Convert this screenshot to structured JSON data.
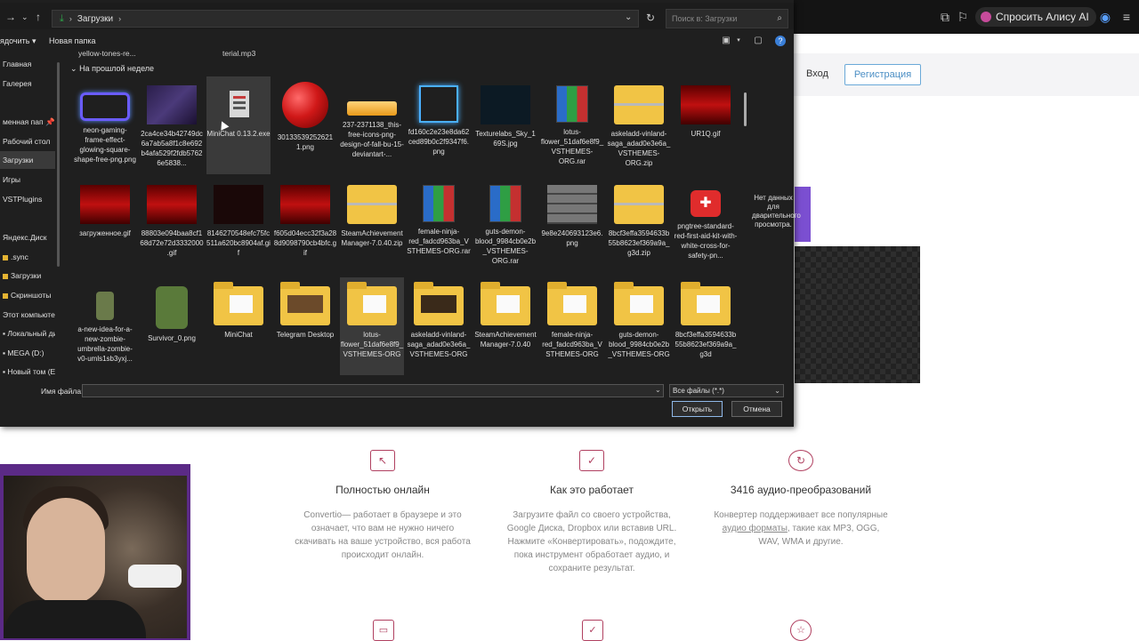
{
  "browser": {
    "alice_label": "Спросить Алису AI"
  },
  "website": {
    "login_label": "Вход",
    "register_label": "Регистрация",
    "features": [
      {
        "title": "Полностью онлайн",
        "text": "Convertio— работает в браузере и это означает, что вам не нужно ничего скачивать на ваше устройство, вся работа происходит онлайн."
      },
      {
        "title": "Как это работает",
        "text": "Загрузите файл со своего устройства, Google Диска, Dropbox или вставив URL. Нажмите «Конвертировать», подождите, пока инструмент обработает аудио, и сохраните результат."
      },
      {
        "title": "3416 аудио-преобразований",
        "text_before": "Конвертер поддерживает все популярные ",
        "text_link": "аудио форматы",
        "text_after": ", такие как MP3, OGG, WAV, WMA и другие."
      }
    ]
  },
  "dialog": {
    "address_path": "Загрузки",
    "search_placeholder": "Поиск в: Загрузки",
    "organize_label": "ядочить ▾",
    "new_folder_label": "Новая папка",
    "sidebar": [
      "Главная",
      "Галерея",
      "менная пап",
      "Рабочий стол",
      "Загрузки",
      "Игры",
      "VSTPlugins",
      "Яндекс.Диск",
      ".sync",
      "Загрузки",
      "Скриншоты",
      "Этот компьюте",
      "Локальный ди",
      "MEGA (D:)",
      "Новый том (E"
    ],
    "top_partial_labels": [
      "yellow-tones-re...",
      "terial.mp3"
    ],
    "group_header": "На прошлой неделе",
    "files": [
      {
        "name": "neon-gaming-frame-effect-glowing-square-shape-free-png.png",
        "thumb": "neon"
      },
      {
        "name": "2ca4ce34b42749dc6a7ab5a8f1c8e692b4afa529f2fdb57626e5838...",
        "thumb": "galaxy"
      },
      {
        "name": "MiniChat 0.13.2.exe",
        "thumb": "exe"
      },
      {
        "name": "30133539252621 1.png",
        "thumb": "ball"
      },
      {
        "name": "237-2371138_this-free-icons-png-design-of-fall-bu-15-deviantart-...",
        "thumb": "bar"
      },
      {
        "name": "fd160c2e23e8da62ced89b0c2f9347f6.png",
        "thumb": "sq"
      },
      {
        "name": "Texturelabs_Sky_169S.jpg",
        "thumb": "space"
      },
      {
        "name": "lotus-flower_51daf6e8f9_VSTHEMES-ORG.rar",
        "thumb": "rar"
      },
      {
        "name": "askeladd-vinland-saga_adad0e3e6a_VSTHEMES-ORG.zip",
        "thumb": "zip"
      },
      {
        "name": "UR1Q.gif",
        "thumb": "red"
      },
      {
        "name": "загруженное.gif",
        "thumb": "red"
      },
      {
        "name": "88803e094baa8cf168d72e72d3332000.gif",
        "thumb": "red"
      },
      {
        "name": "8146270548efc75fc511a620bc8904af.gif",
        "thumb": "dark"
      },
      {
        "name": "f605d04ecc32f3a288d9098790cb4bfc.gif",
        "thumb": "red"
      },
      {
        "name": "SteamAchievementManager-7.0.40.zip",
        "thumb": "zip"
      },
      {
        "name": "female-ninja-red_fadcd963ba_VSTHEMES-ORG.rar",
        "thumb": "rar"
      },
      {
        "name": "guts-demon-blood_9984cb0e2b_VSTHEMES-ORG.rar",
        "thumb": "rar"
      },
      {
        "name": "9e8e240693123e6.png",
        "thumb": "brick"
      },
      {
        "name": "8bcf3effa3594633b55b8623ef369a9a_g3d.zip",
        "thumb": "zip"
      },
      {
        "name": "pngtree-standard-red-first-aid-kit-with-white-cross-for-safety-pn...",
        "thumb": "aid"
      },
      {
        "name": "a-new-idea-for-a-new-zombie-umbrella-zombie-v0-umls1sb3yxj...",
        "thumb": "zombie"
      },
      {
        "name": "Survivor_0.png",
        "thumb": "soldier"
      },
      {
        "name": "MiniChat",
        "thumb": "folder"
      },
      {
        "name": "Telegram Desktop",
        "thumb": "folder tg"
      },
      {
        "name": "lotus-flower_51daf6e8f9_VSTHEMES-ORG",
        "thumb": "folder"
      },
      {
        "name": "askeladd-vinland-saga_adad0e3e6a_VSTHEMES-ORG",
        "thumb": "folder ask"
      },
      {
        "name": "SteamAchievementManager-7.0.40",
        "thumb": "folder"
      },
      {
        "name": "female-ninja-red_fadcd963ba_VSTHEMES-ORG",
        "thumb": "folder"
      },
      {
        "name": "guts-demon-blood_9984cb0e2b_VSTHEMES-ORG",
        "thumb": "folder"
      },
      {
        "name": "8bcf3effa3594633b55b8623ef369a9a_g3d",
        "thumb": "folder"
      }
    ],
    "details_text": "Нет данных для дварительного просмотра.",
    "filename_label": "Имя файла:",
    "filename_value": "",
    "filter_value": "Все файлы (*.*)",
    "open_label": "Открыть",
    "cancel_label": "Отмена"
  }
}
